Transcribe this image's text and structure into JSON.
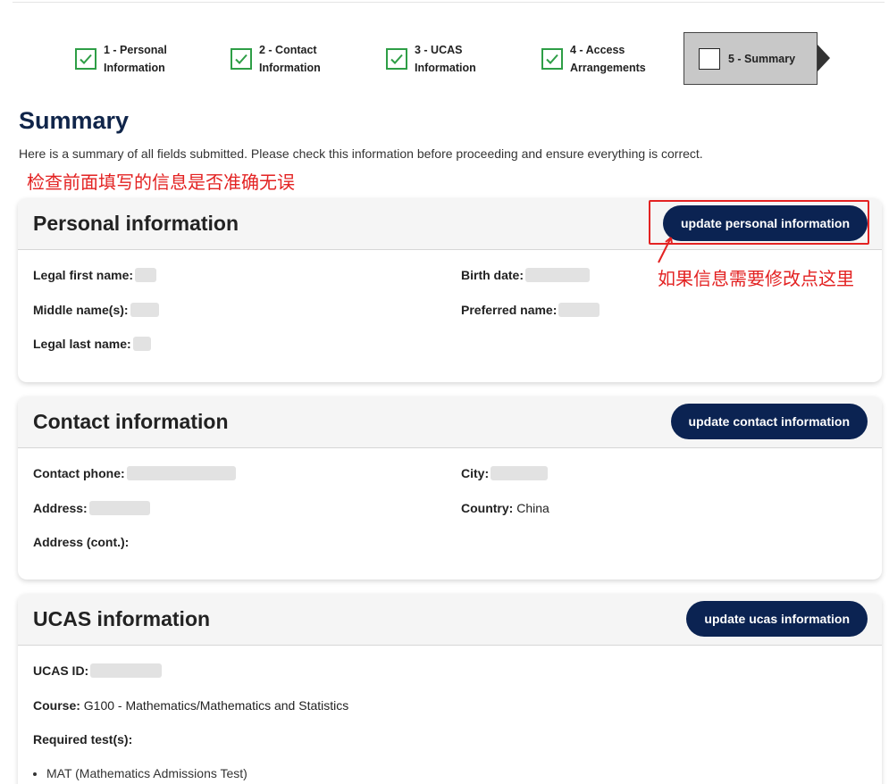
{
  "stepper": {
    "steps": [
      {
        "label": "1 - Personal Information",
        "status": "complete"
      },
      {
        "label": "2 - Contact Information",
        "status": "complete"
      },
      {
        "label": "3 - UCAS Information",
        "status": "complete"
      },
      {
        "label": "4 - Access Arrangements",
        "status": "complete"
      },
      {
        "label": "5 - Summary",
        "status": "current"
      }
    ]
  },
  "page": {
    "title": "Summary",
    "intro": "Here is a summary of all fields submitted. Please check this information before proceeding and ensure everything is correct."
  },
  "annotations": {
    "check_note": "检查前面填写的信息是否准确无误",
    "edit_note": "如果信息需要修改点这里"
  },
  "personal": {
    "title": "Personal information",
    "button": "update personal information",
    "legal_first_name_label": "Legal first name:",
    "middle_names_label": "Middle name(s):",
    "legal_last_name_label": "Legal last name:",
    "birth_date_label": "Birth date:",
    "preferred_name_label": "Preferred name:"
  },
  "contact": {
    "title": "Contact information",
    "button": "update contact information",
    "phone_label": "Contact phone:",
    "address_label": "Address:",
    "address_cont_label": "Address (cont.):",
    "city_label": "City:",
    "country_label": "Country:",
    "country_value": "China"
  },
  "ucas": {
    "title": "UCAS information",
    "button": "update ucas information",
    "id_label": "UCAS ID:",
    "course_label": "Course:",
    "course_value": "G100 - Mathematics/Mathematics and Statistics",
    "tests_label": "Required test(s):",
    "tests": [
      "MAT (Mathematics Admissions Test)"
    ]
  },
  "colors": {
    "check_green": "#2e9e46",
    "button_navy": "#0b2352",
    "title_navy": "#10254a",
    "annotation_red": "#e32222"
  },
  "icons": {
    "step_complete": "checkmark-icon",
    "step_current": "empty-checkbox-icon"
  }
}
